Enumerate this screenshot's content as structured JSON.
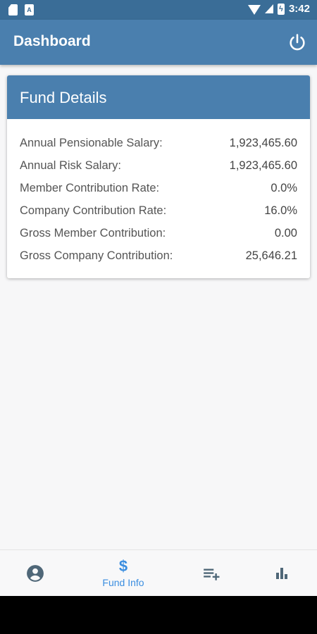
{
  "status_bar": {
    "time": "3:42"
  },
  "app_bar": {
    "title": "Dashboard",
    "power_icon": "power-icon"
  },
  "fund_details": {
    "title": "Fund Details",
    "rows": [
      {
        "label": "Annual Pensionable Salary:",
        "value": "1,923,465.60"
      },
      {
        "label": "Annual Risk Salary:",
        "value": "1,923,465.60"
      },
      {
        "label": "Member Contribution Rate:",
        "value": "0.0%"
      },
      {
        "label": "Company Contribution Rate:",
        "value": "16.0%"
      },
      {
        "label": "Gross Member Contribution:",
        "value": "0.00"
      },
      {
        "label": "Gross Company Contribution:",
        "value": "25,646.21"
      }
    ]
  },
  "bottom_nav": {
    "items": [
      {
        "icon": "account-circle-icon"
      },
      {
        "icon": "dollar-icon",
        "label": "Fund Info",
        "active": true
      },
      {
        "icon": "playlist-add-icon"
      },
      {
        "icon": "bar-chart-icon"
      }
    ]
  },
  "colors": {
    "status_bar": "#3a6d97",
    "app_bar": "#4a7fae",
    "active": "#3b8ee0",
    "inactive_icon": "#4f6778"
  }
}
